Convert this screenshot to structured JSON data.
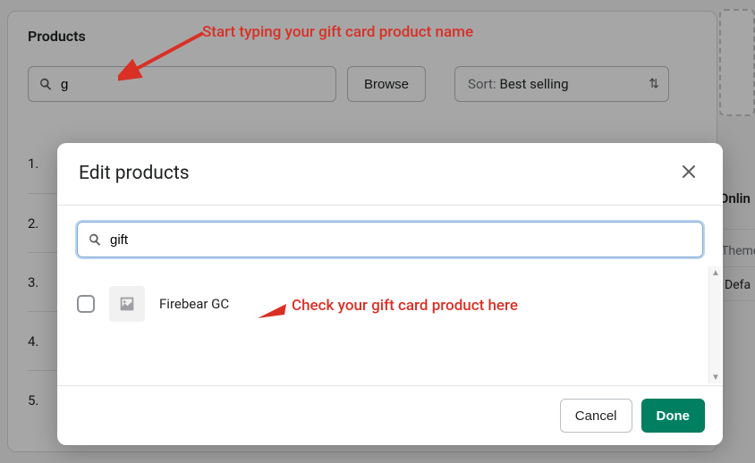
{
  "bg": {
    "title": "Products",
    "search_value": "g",
    "browse_label": "Browse",
    "sort_prefix": "Sort:",
    "sort_value": "Best selling",
    "list_numbers": [
      "1.",
      "2.",
      "3.",
      "4.",
      "5."
    ]
  },
  "right_hint": {
    "label1": "Onlin",
    "label2": "Theme",
    "label3": "Defa"
  },
  "annotations": {
    "a1": "Start typing your gift card product name",
    "a2": "Check your gift card product here"
  },
  "modal": {
    "title": "Edit products",
    "search_value": "gift",
    "results": [
      {
        "name": "Firebear GC"
      }
    ],
    "cancel_label": "Cancel",
    "done_label": "Done"
  }
}
